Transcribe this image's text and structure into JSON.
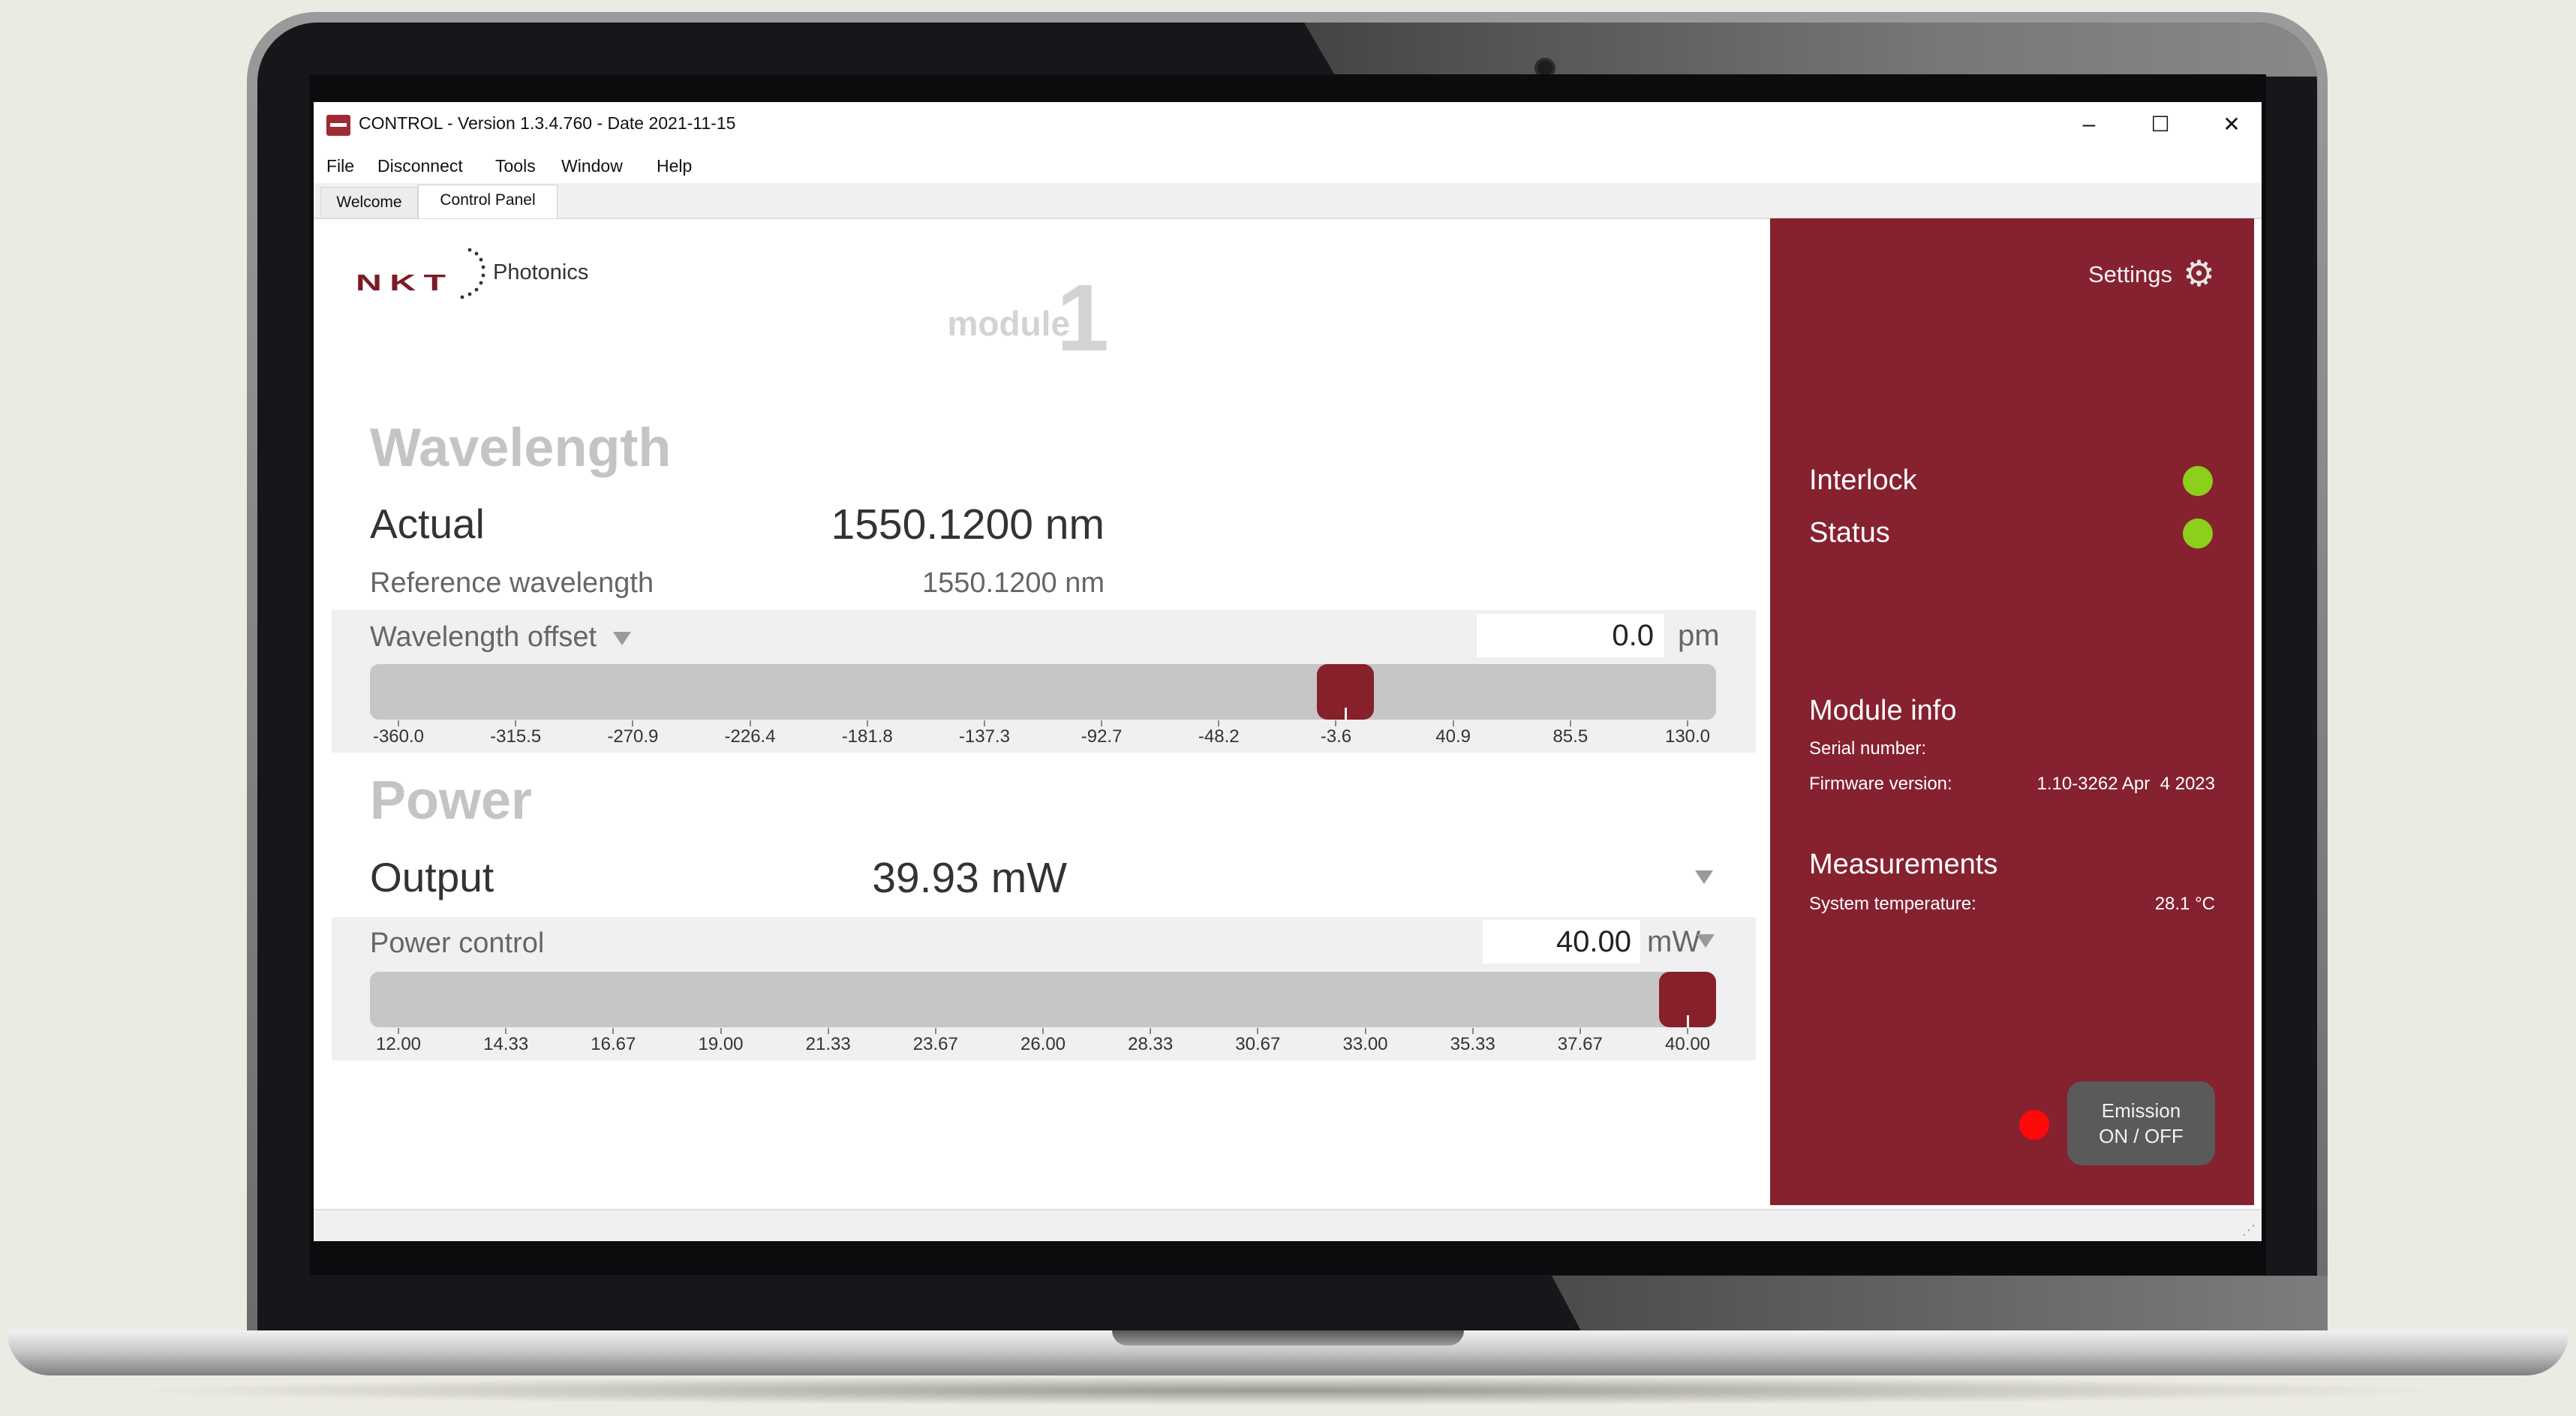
{
  "window": {
    "title": "CONTROL - Version 1.3.4.760 - Date 2021-11-15",
    "controls": {
      "minimize": "–",
      "maximize": "☐",
      "close": "✕"
    }
  },
  "menu": [
    "File",
    "Disconnect",
    "Tools",
    "Window",
    "Help"
  ],
  "tabs": [
    {
      "label": "Welcome",
      "active": false
    },
    {
      "label": "Control Panel",
      "active": true
    }
  ],
  "logo": {
    "brand": "NKT",
    "sub": "Photonics"
  },
  "module": {
    "label": "module",
    "number": "1"
  },
  "wavelength": {
    "title": "Wavelength",
    "actual_label": "Actual",
    "actual_value": "1550.1200 nm",
    "reference_label": "Reference wavelength",
    "reference_value": "1550.1200 nm",
    "offset_label": "Wavelength offset",
    "offset_value": "0.0",
    "offset_unit": "pm",
    "slider": {
      "min": -360.0,
      "max": 130.0,
      "value": 0.0,
      "ticks": [
        "-360.0",
        "-315.5",
        "-270.9",
        "-226.4",
        "-181.8",
        "-137.3",
        "-92.7",
        "-48.2",
        "-3.6",
        "40.9",
        "85.5",
        "130.0"
      ]
    }
  },
  "power": {
    "title": "Power",
    "output_label": "Output",
    "output_value": "39.93 mW",
    "control_label": "Power control",
    "control_value": "40.00",
    "control_unit": "mW",
    "slider": {
      "min": 12.0,
      "max": 40.0,
      "value": 40.0,
      "ticks": [
        "12.00",
        "14.33",
        "16.67",
        "19.00",
        "21.33",
        "23.67",
        "26.00",
        "28.33",
        "30.67",
        "33.00",
        "35.33",
        "37.67",
        "40.00"
      ]
    }
  },
  "panel": {
    "settings_label": "Settings",
    "settings_icon": "gear-icon",
    "interlock_label": "Interlock",
    "interlock_color": "#8ccf1c",
    "status_label": "Status",
    "status_color": "#8ccf1c",
    "module_info_title": "Module info",
    "serial_label": "Serial number:",
    "serial_value": "",
    "firmware_label": "Firmware version:",
    "firmware_value": "1.10-3262 Apr  4 2023",
    "measurements_title": "Measurements",
    "temp_label": "System temperature:",
    "temp_value": "28.1 °C",
    "emission_line1": "Emission",
    "emission_line2": "ON / OFF",
    "emission_color": "#ff0a0a"
  },
  "colors": {
    "accent": "#862130",
    "slider_track": "#c6c6c6",
    "led_green": "#8ccf1c",
    "led_red": "#ff0a0a"
  }
}
